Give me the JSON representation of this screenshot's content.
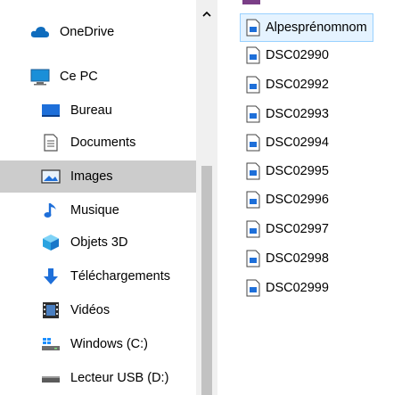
{
  "nav": {
    "items": [
      {
        "label": "OneDrive",
        "icon": "onedrive-cloud-icon",
        "selected": false
      },
      {
        "label": "Ce PC",
        "icon": "computer-icon",
        "selected": false
      },
      {
        "label": "Bureau",
        "icon": "desktop-folder-icon",
        "selected": false
      },
      {
        "label": "Documents",
        "icon": "documents-folder-icon",
        "selected": false
      },
      {
        "label": "Images",
        "icon": "images-folder-icon",
        "selected": true
      },
      {
        "label": "Musique",
        "icon": "music-note-icon",
        "selected": false
      },
      {
        "label": "Objets 3D",
        "icon": "3d-objects-icon",
        "selected": false
      },
      {
        "label": "Téléchargements",
        "icon": "download-arrow-icon",
        "selected": false
      },
      {
        "label": "Vidéos",
        "icon": "videos-film-icon",
        "selected": false
      },
      {
        "label": "Windows (C:)",
        "icon": "windows-drive-icon",
        "selected": false
      },
      {
        "label": "Lecteur USB (D:)",
        "icon": "usb-drive-icon",
        "selected": false
      }
    ]
  },
  "files": {
    "items": [
      {
        "label": "Alpesprénomnom"
      },
      {
        "label": "DSC02990"
      },
      {
        "label": "DSC02992"
      },
      {
        "label": "DSC02993"
      },
      {
        "label": "DSC02994"
      },
      {
        "label": "DSC02995"
      },
      {
        "label": "DSC02996"
      },
      {
        "label": "DSC02997"
      },
      {
        "label": "DSC02998"
      },
      {
        "label": "DSC02999"
      }
    ]
  },
  "colors": {
    "selection_gray": "#cccccc",
    "file_highlight": "#e5f3ff",
    "file_highlight_border": "#99d1ff",
    "accent_blue": "#0f6cbd"
  }
}
